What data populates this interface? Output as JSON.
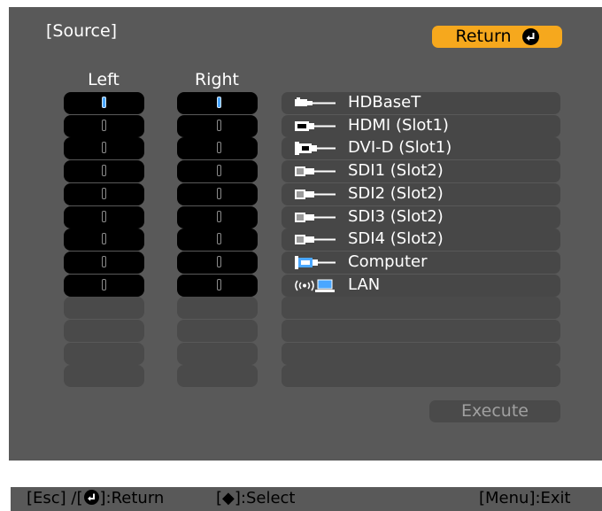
{
  "screen": {
    "title": "[Source]",
    "return_label": "Return",
    "columns": {
      "left": "Left",
      "right": "Right"
    },
    "sources": [
      {
        "icon": "hdbaset-icon",
        "label": "HDBaseT"
      },
      {
        "icon": "hdmi-icon",
        "label": "HDMI (Slot1)"
      },
      {
        "icon": "dvi-d-icon",
        "label": "DVI-D (Slot1)"
      },
      {
        "icon": "sdi-icon",
        "label": "SDI1 (Slot2)"
      },
      {
        "icon": "sdi-icon",
        "label": "SDI2 (Slot2)"
      },
      {
        "icon": "sdi-icon",
        "label": "SDI3 (Slot2)"
      },
      {
        "icon": "sdi-icon",
        "label": "SDI4 (Slot2)"
      },
      {
        "icon": "computer-icon",
        "label": "Computer"
      },
      {
        "icon": "lan-icon",
        "label": "LAN"
      }
    ],
    "empty_rows": 4,
    "selected_left_index": 0,
    "selected_right_index": 0,
    "execute_label": "Execute"
  },
  "footer": {
    "esc_text": "[Esc] /[",
    "return_text": "]:Return",
    "select_text": "[◆]:Select",
    "exit_text": "[Menu]:Exit"
  },
  "colors": {
    "panel": "#595959",
    "accent": "#f6a81d",
    "selected_indicator": "#4aa7ff"
  }
}
